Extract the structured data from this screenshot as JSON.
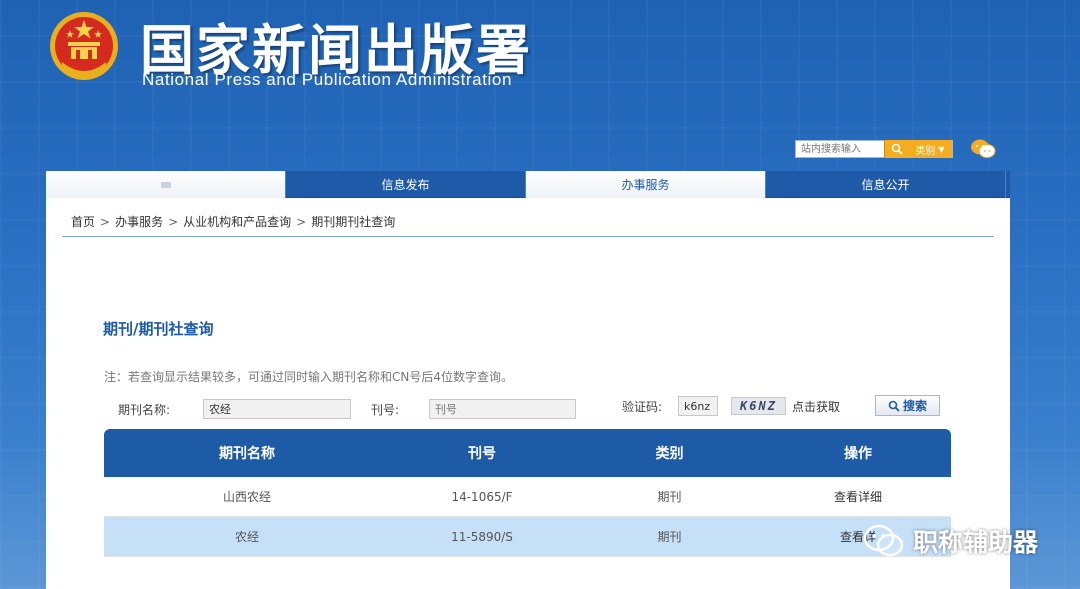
{
  "header": {
    "title": "国家新闻出版署",
    "subtitle": "National  Press and Publication Administration",
    "search_placeholder": "站内搜索输入",
    "category_label": "类别"
  },
  "nav": {
    "items": [
      {
        "label": ""
      },
      {
        "label": "信息发布"
      },
      {
        "label": "办事服务"
      },
      {
        "label": "信息公开"
      }
    ]
  },
  "breadcrumb": {
    "items": [
      "首页",
      "办事服务",
      "从业机构和产品查询",
      "期刊期刊社查询"
    ],
    "separator": ">"
  },
  "page": {
    "title": "期刊/期刊社查询",
    "note": "注：若查询显示结果较多，可通过同时输入期刊名称和CN号后4位数字查询。"
  },
  "form": {
    "name_label": "期刊名称:",
    "name_value": "农经",
    "number_label": "刊号:",
    "number_placeholder": "刊号",
    "captcha_label": "验证码:",
    "captcha_value": "k6nz",
    "captcha_image_text": "K6NZ",
    "refresh_label": "点击获取",
    "search_label": "搜索"
  },
  "table": {
    "headers": [
      "期刊名称",
      "刊号",
      "类别",
      "操作"
    ],
    "rows": [
      {
        "name": "山西农经",
        "number": "14-1065/F",
        "category": "期刊",
        "action": "查看详细"
      },
      {
        "name": "农经",
        "number": "11-5890/S",
        "category": "期刊",
        "action": "查看详"
      }
    ]
  },
  "watermark": {
    "text": "职称辅助器"
  },
  "colors": {
    "primary": "#1d5ba6",
    "accent": "#f5ac1e",
    "row_highlight": "#c6e0f8"
  }
}
